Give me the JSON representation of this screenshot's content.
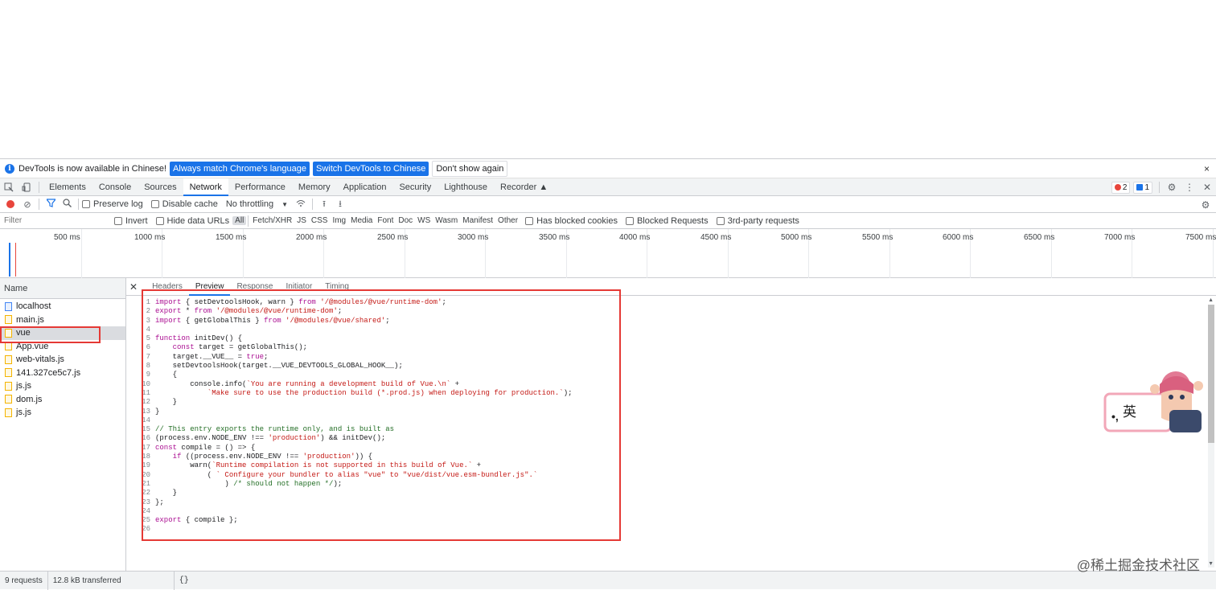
{
  "infobar": {
    "message": "DevTools is now available in Chinese!",
    "btn_match": "Always match Chrome's language",
    "btn_switch": "Switch DevTools to Chinese",
    "btn_dont_show": "Don't show again",
    "close": "×"
  },
  "tabs": [
    "Elements",
    "Console",
    "Sources",
    "Network",
    "Performance",
    "Memory",
    "Application",
    "Security",
    "Lighthouse",
    "Recorder"
  ],
  "counters": {
    "errors": "2",
    "messages": "1"
  },
  "toolbar": {
    "preserve_log": "Preserve log",
    "disable_cache": "Disable cache",
    "throttling": "No throttling"
  },
  "filter": {
    "placeholder": "Filter",
    "invert": "Invert",
    "hide_data_urls": "Hide data URLs",
    "types": [
      "All",
      "Fetch/XHR",
      "JS",
      "CSS",
      "Img",
      "Media",
      "Font",
      "Doc",
      "WS",
      "Wasm",
      "Manifest",
      "Other"
    ],
    "has_blocked_cookies": "Has blocked cookies",
    "blocked_requests": "Blocked Requests",
    "third_party": "3rd-party requests"
  },
  "timeline": {
    "ticks": [
      "500 ms",
      "1000 ms",
      "1500 ms",
      "2000 ms",
      "2500 ms",
      "3000 ms",
      "3500 ms",
      "4000 ms",
      "4500 ms",
      "5000 ms",
      "5500 ms",
      "6000 ms",
      "6500 ms",
      "7000 ms",
      "7500 ms"
    ]
  },
  "requests": {
    "header": "Name",
    "items": [
      "localhost",
      "main.js",
      "vue",
      "App.vue",
      "web-vitals.js",
      "141.327ce5c7.js",
      "js.js",
      "dom.js",
      "js.js"
    ],
    "selected_index": 2
  },
  "panel_tabs": [
    "Headers",
    "Preview",
    "Response",
    "Initiator",
    "Timing"
  ],
  "code_lines": [
    [
      [
        "kw",
        "import"
      ],
      [
        "plain",
        " { setDevtoolsHook, warn } "
      ],
      [
        "kw",
        "from"
      ],
      [
        "str",
        " '/@modules/@vue/runtime-dom'"
      ],
      [
        "plain",
        ";"
      ]
    ],
    [
      [
        "kw",
        "export"
      ],
      [
        "plain",
        " * "
      ],
      [
        "kw",
        "from"
      ],
      [
        "str",
        " '/@modules/@vue/runtime-dom'"
      ],
      [
        "plain",
        ";"
      ]
    ],
    [
      [
        "kw",
        "import"
      ],
      [
        "plain",
        " { getGlobalThis } "
      ],
      [
        "kw",
        "from"
      ],
      [
        "str",
        " '/@modules/@vue/shared'"
      ],
      [
        "plain",
        ";"
      ]
    ],
    [],
    [
      [
        "kw",
        "function"
      ],
      [
        "plain",
        " initDev() {"
      ]
    ],
    [
      [
        "plain",
        "    "
      ],
      [
        "kw",
        "const"
      ],
      [
        "plain",
        " target = getGlobalThis();"
      ]
    ],
    [
      [
        "plain",
        "    target.__VUE__ = "
      ],
      [
        "kw",
        "true"
      ],
      [
        "plain",
        ";"
      ]
    ],
    [
      [
        "plain",
        "    setDevtoolsHook(target.__VUE_DEVTOOLS_GLOBAL_HOOK__);"
      ]
    ],
    [
      [
        "plain",
        "    {"
      ]
    ],
    [
      [
        "plain",
        "        console.info("
      ],
      [
        "str",
        "`You are running a development build of Vue.\\n`"
      ],
      [
        "plain",
        " +"
      ]
    ],
    [
      [
        "str",
        "            `Make sure to use the production build (*.prod.js) when deploying for production.`"
      ],
      [
        "plain",
        ");"
      ]
    ],
    [
      [
        "plain",
        "    }"
      ]
    ],
    [
      [
        "plain",
        "}"
      ]
    ],
    [],
    [
      [
        "cm",
        "// This entry exports the runtime only, and is built as"
      ]
    ],
    [
      [
        "plain",
        "(process.env.NODE_ENV !== "
      ],
      [
        "str",
        "'production'"
      ],
      [
        "plain",
        ") && initDev();"
      ]
    ],
    [
      [
        "kw",
        "const"
      ],
      [
        "plain",
        " compile = () => {"
      ]
    ],
    [
      [
        "plain",
        "    "
      ],
      [
        "kw",
        "if"
      ],
      [
        "plain",
        " ((process.env.NODE_ENV !== "
      ],
      [
        "str",
        "'production'"
      ],
      [
        "plain",
        ")) {"
      ]
    ],
    [
      [
        "plain",
        "        warn("
      ],
      [
        "str",
        "`Runtime compilation is not supported in this build of Vue.`"
      ],
      [
        "plain",
        " +"
      ]
    ],
    [
      [
        "plain",
        "            ( "
      ],
      [
        "str",
        "` Configure your bundler to alias \"vue\" to \"vue/dist/vue.esm-bundler.js\".`"
      ]
    ],
    [
      [
        "plain",
        "                ) "
      ],
      [
        "cm",
        "/* should not happen */"
      ],
      [
        "plain",
        ");"
      ]
    ],
    [
      [
        "plain",
        "    }"
      ]
    ],
    [
      [
        "plain",
        "};"
      ]
    ],
    [],
    [
      [
        "kw",
        "export"
      ],
      [
        "plain",
        " { compile };"
      ]
    ],
    []
  ],
  "status": {
    "requests": "9 requests",
    "transferred": "12.8 kB transferred",
    "braces": "{}"
  },
  "mascot": {
    "char": "英",
    "mark": "•,"
  },
  "watermark": "@稀土掘金技术社区",
  "colors": {
    "accent": "#1a73e8",
    "highlight": "#e53935",
    "record": "#e8453c"
  }
}
